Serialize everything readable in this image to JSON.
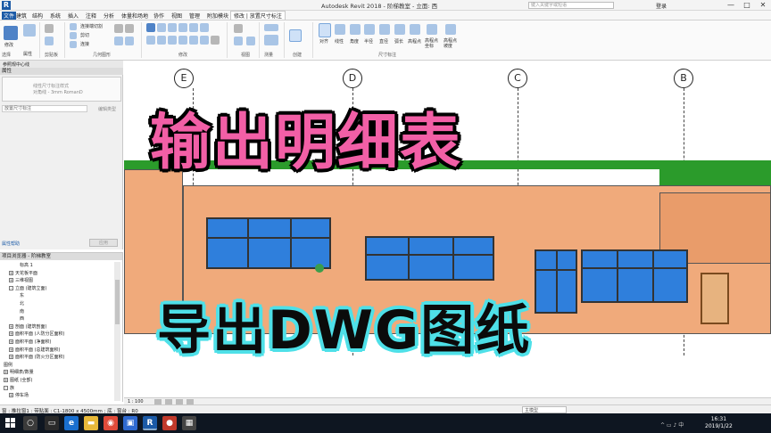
{
  "titlebar": {
    "title": "Autodesk Revit 2018 -  阶梯教室 - 立面: 西",
    "search_placeholder": "键入关键字或短语",
    "login": "登录",
    "controls": [
      "—",
      "□",
      "✕"
    ]
  },
  "menu": {
    "tabs": [
      "文件",
      "建筑",
      "结构",
      "系统",
      "插入",
      "注释",
      "分析",
      "体量和场地",
      "协作",
      "视图",
      "管理",
      "附加模块",
      "修改 | 放置尺寸标注"
    ]
  },
  "ribbon": {
    "modify_label": "修改",
    "select_label": "选择",
    "props_label": "属性",
    "clipboard_label": "剪贴板",
    "geometry_label": "几何图形",
    "modify_panel_label": "修改",
    "view_label": "视图",
    "measure_label": "测量",
    "create_label": "创建",
    "dimension_panel_label": "尺寸标注",
    "cut_label": "连接端切割",
    "cut2_label": "剪切",
    "join_label": "连接",
    "dim_tools": [
      "对齐",
      "线性",
      "角度",
      "半径",
      "直径",
      "弧长",
      "高程点",
      "高程点 坐标",
      "高程点 坡度"
    ]
  },
  "viewtabs": {
    "label": "参照规中心线"
  },
  "properties": {
    "header": "属性",
    "type_line1": "线性尺寸标注样式",
    "type_line2": "对角线 - 3mm RomanD",
    "selector": "放置尺寸标注",
    "edit_type": "编辑类型",
    "help": "属性帮助",
    "apply": "应用"
  },
  "browser": {
    "header": "项目浏览器 - 阶梯教室",
    "items": [
      {
        "label": "标高 1",
        "indent": 3,
        "box": ""
      },
      {
        "label": "天花板平面",
        "indent": 1,
        "box": "+"
      },
      {
        "label": "三维视图",
        "indent": 1,
        "box": "+"
      },
      {
        "label": "立面 (建筑立面)",
        "indent": 1,
        "box": "-"
      },
      {
        "label": "东",
        "indent": 3,
        "box": ""
      },
      {
        "label": "北",
        "indent": 3,
        "box": ""
      },
      {
        "label": "南",
        "indent": 3,
        "box": ""
      },
      {
        "label": "西",
        "indent": 3,
        "box": ""
      },
      {
        "label": "剖面 (建筑剖面)",
        "indent": 1,
        "box": "+"
      },
      {
        "label": "面积平面 (人防分区面积)",
        "indent": 1,
        "box": "+"
      },
      {
        "label": "面积平面 (净面积)",
        "indent": 1,
        "box": "+"
      },
      {
        "label": "面积平面 (总建筑面积)",
        "indent": 1,
        "box": "+"
      },
      {
        "label": "面积平面 (防火分区面积)",
        "indent": 1,
        "box": "+"
      },
      {
        "label": "图例",
        "indent": 0,
        "box": ""
      },
      {
        "label": "明细表/数量",
        "indent": 0,
        "box": "+"
      },
      {
        "label": "图纸 (全部)",
        "indent": 0,
        "box": "+"
      },
      {
        "label": "族",
        "indent": 0,
        "box": "-"
      },
      {
        "label": "停车场",
        "indent": 1,
        "box": "+"
      }
    ]
  },
  "canvas": {
    "grid_labels": [
      "E",
      "D",
      "C",
      "B"
    ],
    "overlay_title": "输出明细表",
    "overlay_subtitle": "导出DWG图纸"
  },
  "viewbar": {
    "scale": "1 : 100"
  },
  "status": {
    "text": "窗 : 推拉窗1 : 带贴面 : C1-1800 x 4500mm ; 底 : 窗台 : R0",
    "model": "主模型"
  },
  "taskbar": {
    "time": "16:31",
    "date": "2019/1/22",
    "tray": "^ ▭ ♪ 中"
  },
  "colors": {
    "overlay_title": "#f25fa6",
    "overlay_outline": "#4ee0e8",
    "wall": "#f0aa7b",
    "window": "#2f7fdc",
    "roof": "#2b9b2b"
  }
}
